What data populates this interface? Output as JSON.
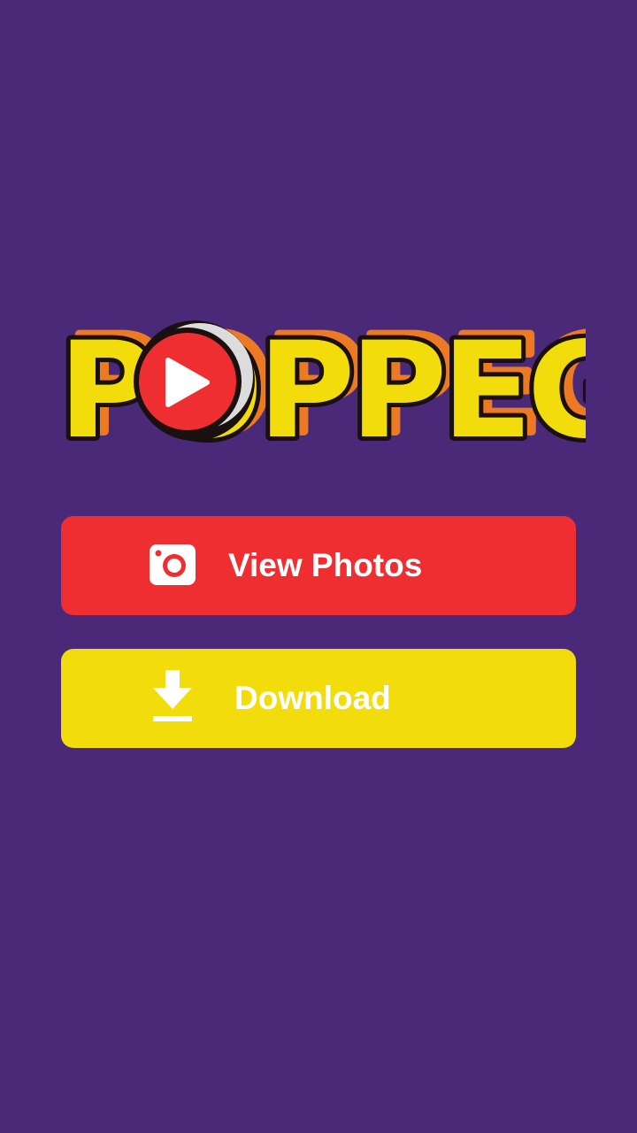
{
  "logo": {
    "text": "POPPEG",
    "colors": {
      "fill": "#f2dc0c",
      "outline": "#1a1010",
      "shadow": "#ec7a23",
      "play_circle": "#ee2e31"
    }
  },
  "buttons": {
    "view_photos": {
      "label": "View Photos",
      "icon": "camera-icon",
      "color": "#ee2e31"
    },
    "download": {
      "label": "Download",
      "icon": "download-icon",
      "color": "#f2dc0c"
    }
  },
  "background_color": "#4a2a78"
}
